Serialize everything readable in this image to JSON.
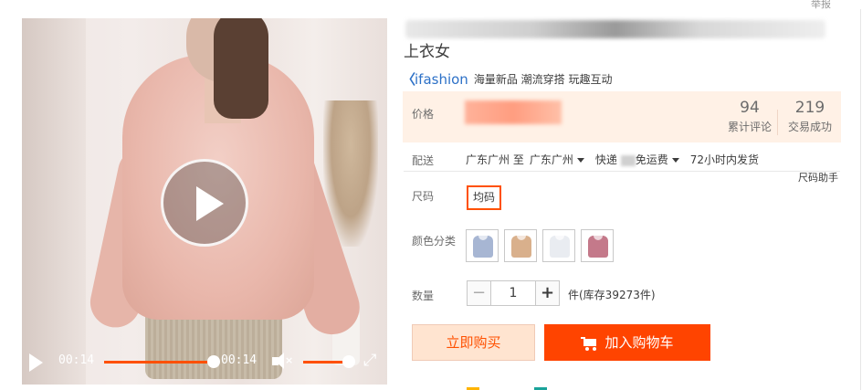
{
  "header": {
    "report_label": "举报"
  },
  "product": {
    "title_tail": "上衣女",
    "brand": {
      "logo_text": "ifashion",
      "logo_color": "#2d71c7",
      "tags": "海量新品 潮流穿搭 玩趣互动"
    }
  },
  "video": {
    "current_time": "00:14",
    "duration": "00:14",
    "progress_fraction": 1.0,
    "volume_fraction": 1.0,
    "icons": [
      "play-icon",
      "mute-icon",
      "fullscreen-icon"
    ]
  },
  "price": {
    "label": "价格",
    "stats": [
      {
        "value": "94",
        "label": "累计评论"
      },
      {
        "value": "219",
        "label": "交易成功"
      }
    ]
  },
  "shipping": {
    "label": "配送",
    "origin": "广东广州 至",
    "destination": "广东广州",
    "method": "快递",
    "fee_suffix": "免运费",
    "dispatch": "72小时内发货"
  },
  "size": {
    "label": "尺码",
    "help_link": "尺码助手",
    "options": [
      "均码"
    ],
    "selected": "均码"
  },
  "color": {
    "label": "颜色分类",
    "swatches": [
      {
        "name": "blue",
        "color": "#a7b6d3"
      },
      {
        "name": "khaki",
        "color": "#d9b08c"
      },
      {
        "name": "white",
        "color": "#e9ecf1"
      },
      {
        "name": "rose",
        "color": "#c4798a"
      }
    ]
  },
  "quantity": {
    "label": "数量",
    "value": "1",
    "minus": "−",
    "plus": "+",
    "stock_text": "件(库存39273件)"
  },
  "actions": {
    "buy_now": "立即购买",
    "add_to_cart": "加入购物车",
    "accent_color": "#ff4400"
  }
}
